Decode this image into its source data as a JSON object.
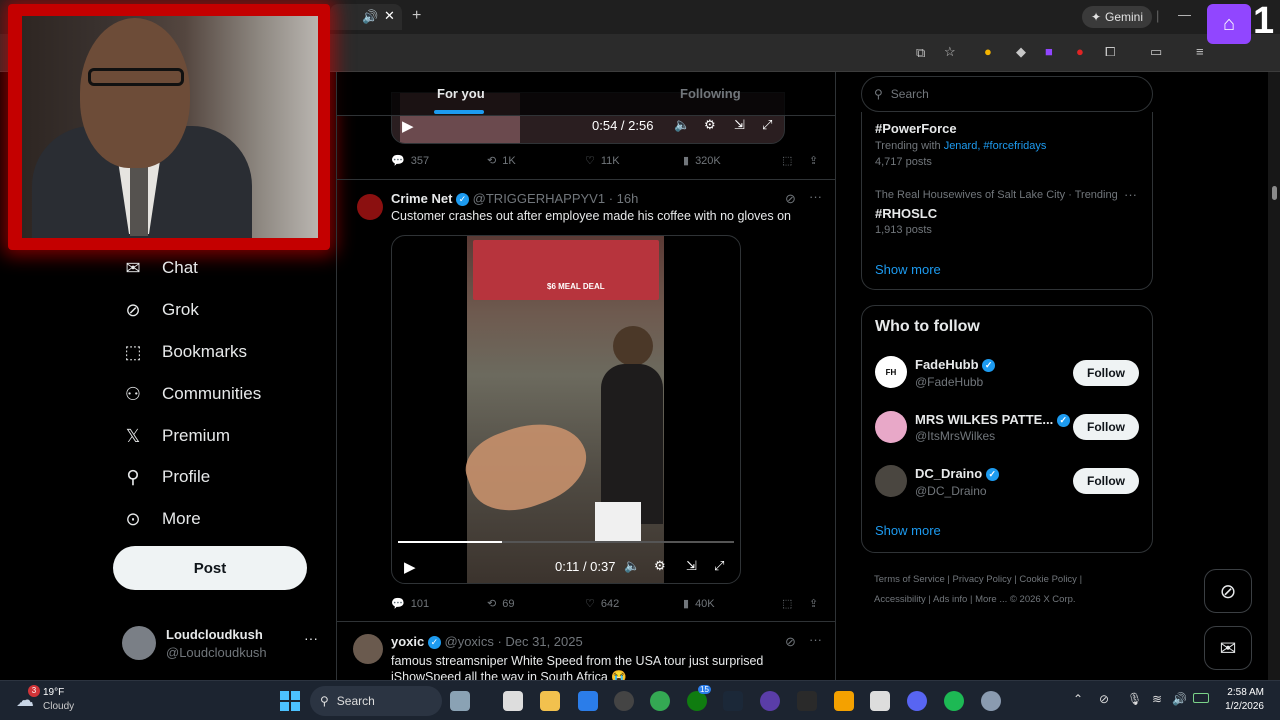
{
  "browser": {
    "gemini_label": "Gemini",
    "twitch_number": "1"
  },
  "feed_tabs": {
    "for_you": "For you",
    "following": "Following"
  },
  "tweet1": {
    "video_time": "0:54 / 2:56",
    "replies": "357",
    "retweets": "1K",
    "likes": "11K",
    "views": "320K"
  },
  "tweet2": {
    "name": "Crime Net",
    "handle": "@TRIGGERHAPPYV1",
    "time": "· 16h",
    "text": "Customer crashes out after employee made his coffee with no gloves on",
    "video_time": "0:11 / 0:37",
    "menu_sign": "$6 MEAL DEAL",
    "replies": "101",
    "retweets": "69",
    "likes": "642",
    "views": "40K"
  },
  "tweet3": {
    "name": "yoxic",
    "handle": "@yoxics",
    "time": "· Dec 31, 2025",
    "text": "famous streamsniper White Speed from the USA tour just surprised iShowSpeed all the way in South Africa 😭"
  },
  "nav": {
    "chat": "Chat",
    "grok": "Grok",
    "bookmarks": "Bookmarks",
    "communities": "Communities",
    "premium": "Premium",
    "profile": "Profile",
    "more": "More",
    "post": "Post"
  },
  "account": {
    "name": "Loudcloudkush",
    "handle": "@Loudcloudkush"
  },
  "search": {
    "placeholder": "Search"
  },
  "trends": [
    {
      "tag": "#PowerForce",
      "context_prefix": "Trending with",
      "links": "Jenard, #forcefridays",
      "posts": "4,717 posts"
    },
    {
      "context": "The Real Housewives of Salt Lake City · Trending",
      "tag": "#RHOSLC",
      "posts": "1,913 posts"
    }
  ],
  "trends_show_more": "Show more",
  "who_to_follow": {
    "title": "Who to follow",
    "users": [
      {
        "name": "FadeHubb",
        "handle": "@FadeHubb",
        "button": "Follow"
      },
      {
        "name": "MRS WILKES PATTE...",
        "handle": "@ItsMrsWilkes",
        "button": "Follow"
      },
      {
        "name": "DC_Draino",
        "handle": "@DC_Draino",
        "button": "Follow"
      }
    ],
    "show_more": "Show more"
  },
  "footer": {
    "terms": "Terms of Service",
    "privacy": "Privacy Policy",
    "cookie": "Cookie Policy",
    "accessibility": "Accessibility",
    "ads": "Ads info",
    "more": "More ...",
    "copyright": "© 2026 X Corp."
  },
  "taskbar": {
    "weather_temp": "19°F",
    "weather_desc": "Cloudy",
    "weather_badge": "3",
    "search": "Search",
    "time": "2:58 AM",
    "date": "1/2/2026",
    "xbox_badge": "15"
  },
  "colors": {
    "accent": "#1d9bf0",
    "twitch": "#9146ff",
    "webcam_border": "#c40000"
  }
}
